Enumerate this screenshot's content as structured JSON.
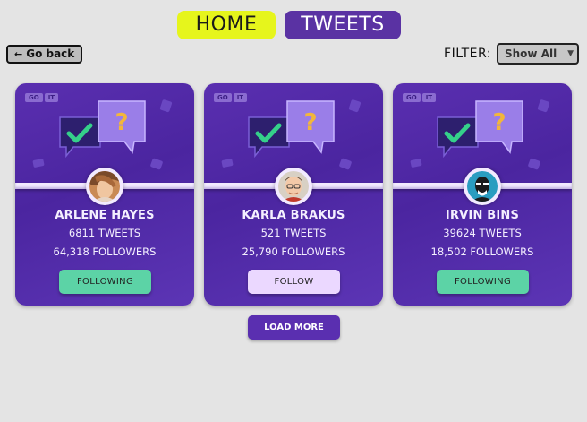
{
  "nav": {
    "home_label": "HOME",
    "tweets_label": "TWEETS"
  },
  "back": {
    "label": "Go back"
  },
  "filter": {
    "label": "FILTER:",
    "selected": "Show All"
  },
  "logo": {
    "part1": "GO",
    "part2": "IT"
  },
  "cards": [
    {
      "name": "ARLENE HAYES",
      "tweets": "6811 TWEETS",
      "followers": "64,318 FOLLOWERS",
      "button_label": "FOLLOWING",
      "button_state": "following"
    },
    {
      "name": "KARLA BRAKUS",
      "tweets": "521 TWEETS",
      "followers": "25,790 FOLLOWERS",
      "button_label": "FOLLOW",
      "button_state": "follow"
    },
    {
      "name": "IRVIN BINS",
      "tweets": "39624 TWEETS",
      "followers": "18,502 FOLLOWERS",
      "button_label": "FOLLOWING",
      "button_state": "following"
    }
  ],
  "load_more_label": "LOAD MORE",
  "colors": {
    "accent": "#5a2fb0",
    "home": "#e6f51c",
    "following": "#5cd3a6",
    "follow": "#ebd8ff"
  }
}
